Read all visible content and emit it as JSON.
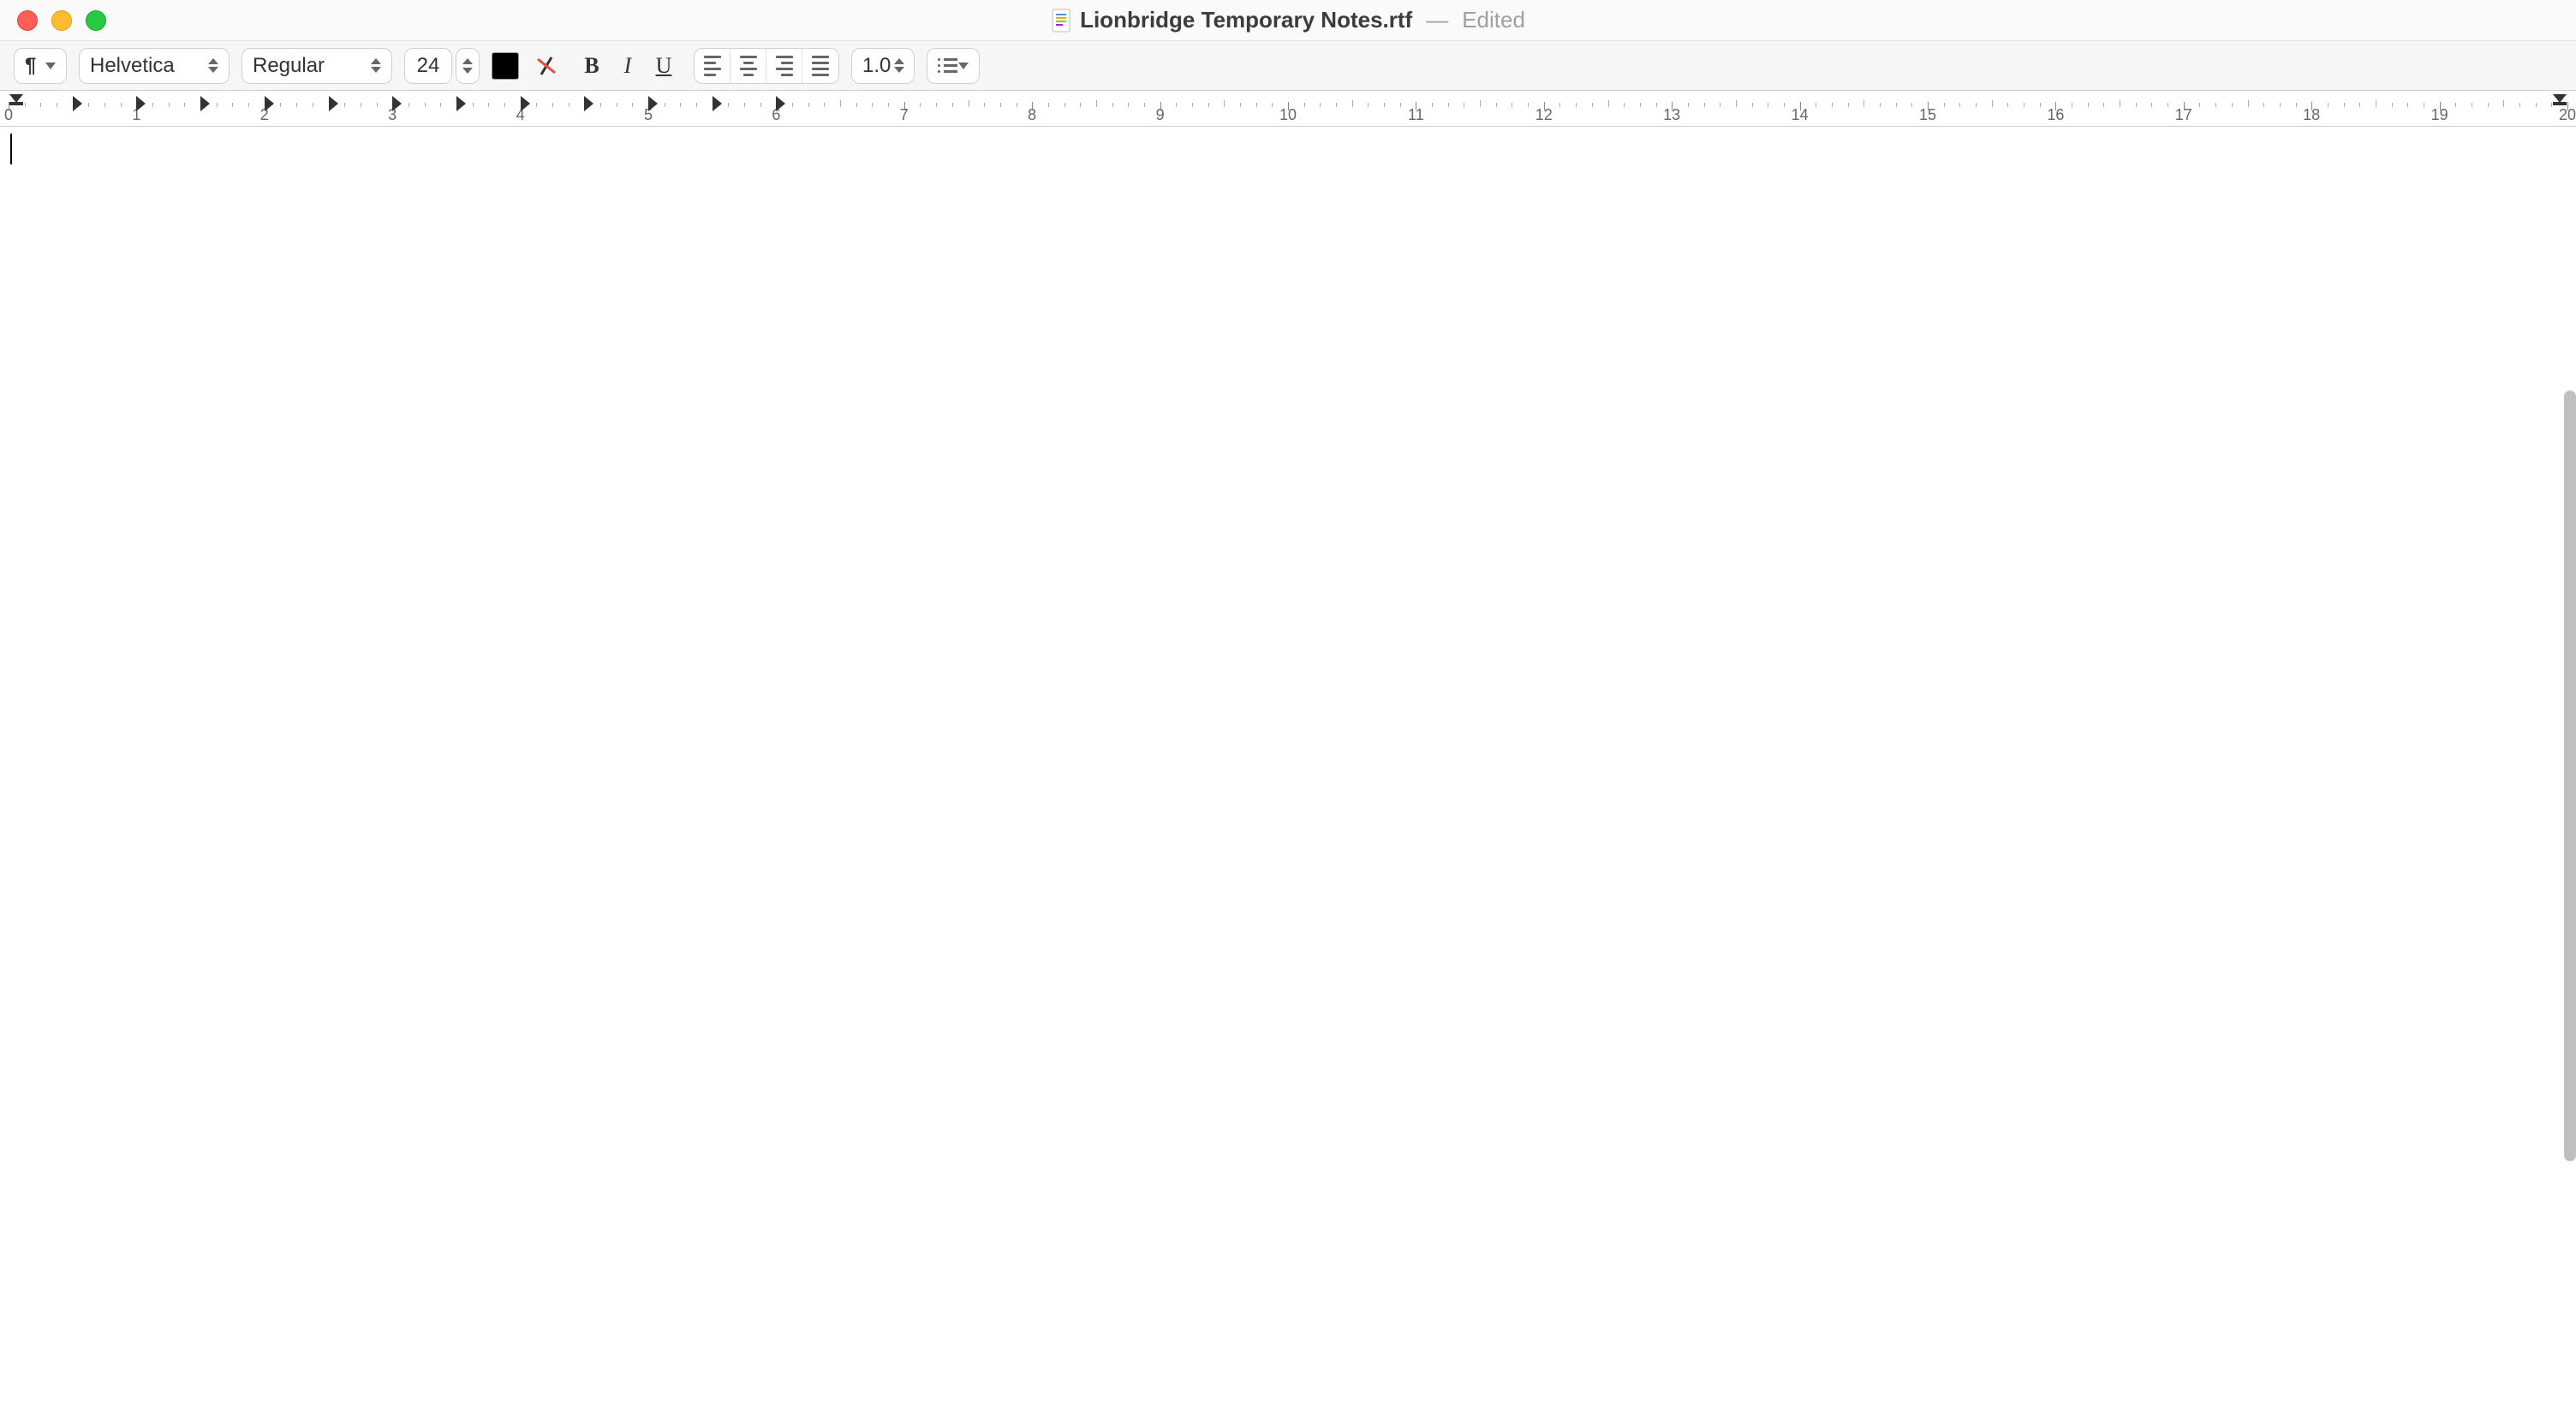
{
  "titlebar": {
    "filename": "Lionbridge Temporary Notes.rtf",
    "separator": "—",
    "status": "Edited"
  },
  "toolbar": {
    "paragraph_glyph": "¶",
    "font_family": "Helvetica",
    "font_style": "Regular",
    "font_size": "24",
    "line_spacing": "1.0",
    "text_color": "#000000"
  },
  "ruler": {
    "numbers": [
      "0",
      "1",
      "2",
      "3",
      "4",
      "5",
      "6",
      "7",
      "8",
      "9",
      "10",
      "11",
      "12",
      "13",
      "14",
      "15",
      "16",
      "17",
      "18",
      "19",
      "20"
    ],
    "tab_stops_cm": [
      0.5,
      1,
      1.5,
      2,
      2.5,
      3,
      3.5,
      4,
      4.5,
      5,
      5.5,
      6
    ]
  }
}
